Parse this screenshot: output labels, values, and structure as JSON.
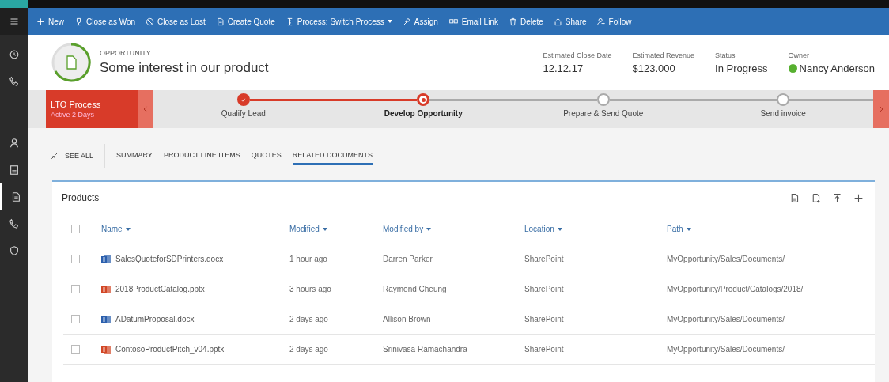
{
  "nav": {
    "items": [
      {
        "selected": false
      },
      {
        "selected": false
      },
      {
        "selected": false
      },
      {
        "selected": false
      },
      {
        "selected": true
      },
      {
        "selected": false
      },
      {
        "selected": false
      }
    ]
  },
  "commands": [
    {
      "label": "New",
      "dropdown": false
    },
    {
      "label": "Close as Won",
      "dropdown": false
    },
    {
      "label": "Close as Lost",
      "dropdown": false
    },
    {
      "label": "Create Quote",
      "dropdown": false
    },
    {
      "label": "Process: Switch Process",
      "dropdown": true
    },
    {
      "label": "Assign",
      "dropdown": false
    },
    {
      "label": "Email Link",
      "dropdown": false
    },
    {
      "label": "Delete",
      "dropdown": false
    },
    {
      "label": "Share",
      "dropdown": false
    },
    {
      "label": "Follow",
      "dropdown": false
    }
  ],
  "record": {
    "entity": "OPPORTUNITY",
    "title": "Some interest in our product",
    "fields": [
      {
        "label": "Estimated Close Date",
        "value": "12.12.17"
      },
      {
        "label": "Estimated Revenue",
        "value": "$123.000"
      },
      {
        "label": "Status",
        "value": "In Progress"
      },
      {
        "label": "Owner",
        "value": "Nancy Anderson",
        "online": true
      }
    ]
  },
  "process": {
    "name": "LTO Process",
    "duration": "Active 2 Days",
    "stages": [
      {
        "label": "Qualify Lead",
        "kind": "done"
      },
      {
        "label": "Develop Opportunity",
        "kind": "active"
      },
      {
        "label": "Prepare & Send Quote",
        "kind": "pending"
      },
      {
        "label": "Send invoice",
        "kind": "pending"
      }
    ]
  },
  "see_all": "SEE ALL",
  "tabs": [
    {
      "label": "SUMMARY",
      "selected": false
    },
    {
      "label": "PRODUCT LINE ITEMS",
      "selected": false
    },
    {
      "label": "QUOTES",
      "selected": false
    },
    {
      "label": "RELATED DOCUMENTS",
      "selected": true
    }
  ],
  "panel": {
    "title": "Products",
    "select_all_checked": false,
    "columns": [
      "Name",
      "Modified",
      "Modified by",
      "Location",
      "Path"
    ],
    "rows": [
      {
        "checked": false,
        "kind": "word",
        "name": "SalesQuoteforSDPrinters.docx",
        "modified": "1 hour ago",
        "modified_by": "Darren Parker",
        "location": "SharePoint",
        "path": "MyOpportunity/Sales/Documents/"
      },
      {
        "checked": false,
        "kind": "powerpoint",
        "name": "2018ProductCatalog.pptx",
        "modified": "3 hours ago",
        "modified_by": "Raymond Cheung",
        "location": "SharePoint",
        "path": "MyOpportunity/Product/Catalogs/2018/"
      },
      {
        "checked": false,
        "kind": "word",
        "name": "ADatumProposal.docx",
        "modified": "2 days ago",
        "modified_by": "Allison Brown",
        "location": "SharePoint",
        "path": "MyOpportunity/Sales/Documents/"
      },
      {
        "checked": false,
        "kind": "powerpoint",
        "name": "ContosoProductPitch_v04.pptx",
        "modified": "2 days ago",
        "modified_by": "Srinivasa Ramachandra",
        "location": "SharePoint",
        "path": "MyOpportunity/Sales/Documents/"
      }
    ]
  }
}
